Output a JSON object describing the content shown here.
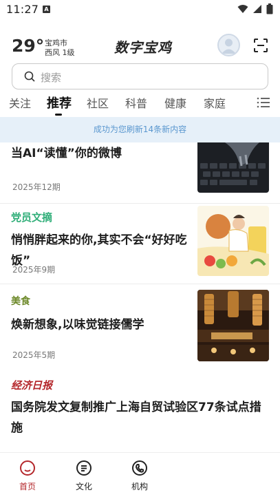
{
  "status_bar": {
    "time": "11:27",
    "sim_badge": "A"
  },
  "header": {
    "temperature": "29°",
    "city": "宝鸡市",
    "wind": "西风 1级",
    "brand": "数字宝鸡",
    "accent_color": "#b4272b"
  },
  "search": {
    "placeholder": "搜索"
  },
  "tabs": {
    "items": [
      {
        "label": "关注"
      },
      {
        "label": "推荐",
        "active": true
      },
      {
        "label": "社区"
      },
      {
        "label": "科普"
      },
      {
        "label": "健康"
      },
      {
        "label": "家庭"
      }
    ]
  },
  "refresh_banner": {
    "text": "成功为您刷新14条新内容"
  },
  "feed": {
    "articles": [
      {
        "source": "",
        "title": "当AI“读懂”你的微博",
        "date": "2025年12期",
        "thumb_icon": "keyboard-photo"
      },
      {
        "source": "党员文摘",
        "source_color": "#2fae78",
        "title": "悄悄胖起来的你,其实不会“好好吃饭”",
        "date": "2025年9期",
        "thumb_icon": "food-illustration"
      },
      {
        "source": "美食",
        "source_color": "#6e8a2b",
        "title": "焕新想象,以味觉链接儒学",
        "date": "2025年5期",
        "thumb_icon": "restaurant-photo"
      },
      {
        "source": "经济日报",
        "source_color": "#b4272b",
        "title": "国务院发文复制推广上海自贸试验区77条试点措施",
        "date": ""
      }
    ]
  },
  "bottom_nav": {
    "items": [
      {
        "label": "首页",
        "icon": "home-icon",
        "active": true
      },
      {
        "label": "文化",
        "icon": "culture-icon"
      },
      {
        "label": "机构",
        "icon": "organization-icon"
      }
    ]
  }
}
